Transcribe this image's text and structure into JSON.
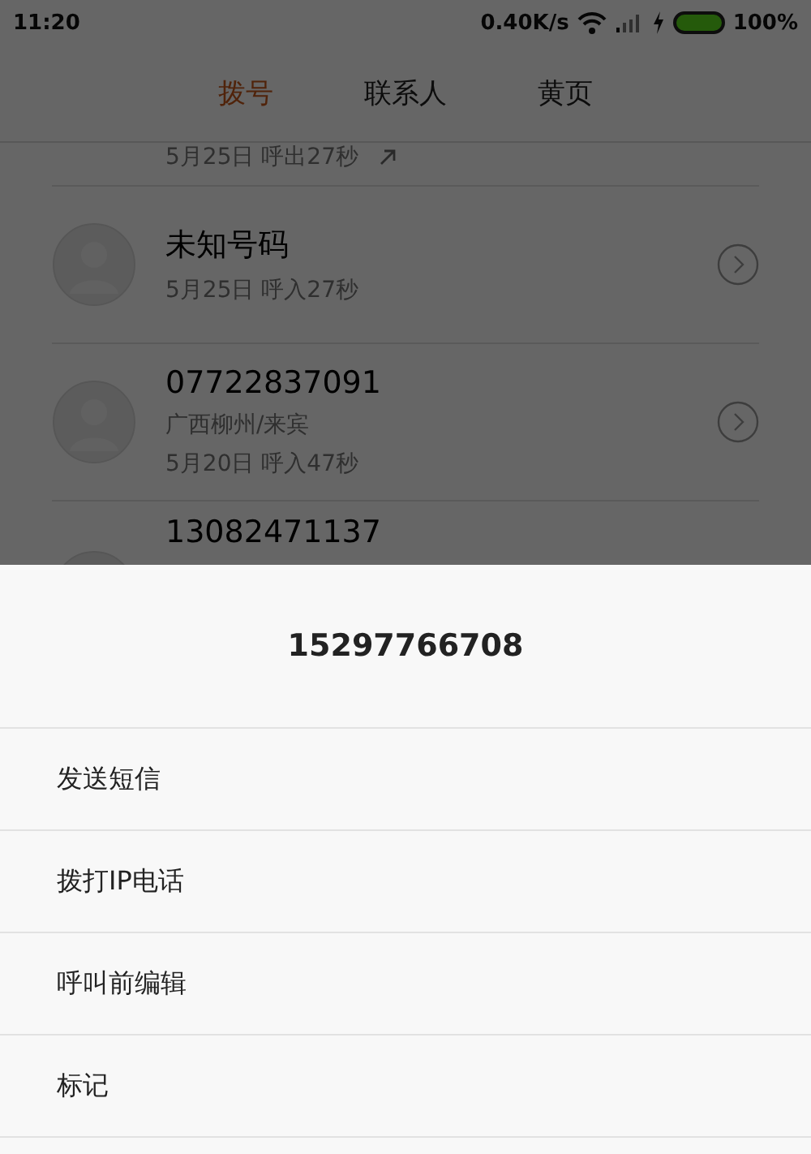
{
  "status_bar": {
    "time": "11:20",
    "speed": "0.40K/s",
    "battery_text": "100%"
  },
  "tabs": [
    {
      "label": "拨号",
      "selected": true
    },
    {
      "label": "联系人",
      "selected": false
    },
    {
      "label": "黄页",
      "selected": false
    }
  ],
  "calls": [
    {
      "call": "5月25日 呼出27秒",
      "outgoing": true
    },
    {
      "name": "未知号码",
      "call": "5月25日 呼入27秒"
    },
    {
      "name": "07722837091",
      "location": "广西柳州/来宾",
      "call": "5月20日 呼入47秒"
    },
    {
      "name": "13082471137"
    }
  ],
  "sheet": {
    "title": "15297766708",
    "items": [
      "发送短信",
      "拨打IP电话",
      "呼叫前编辑",
      "标记"
    ]
  }
}
